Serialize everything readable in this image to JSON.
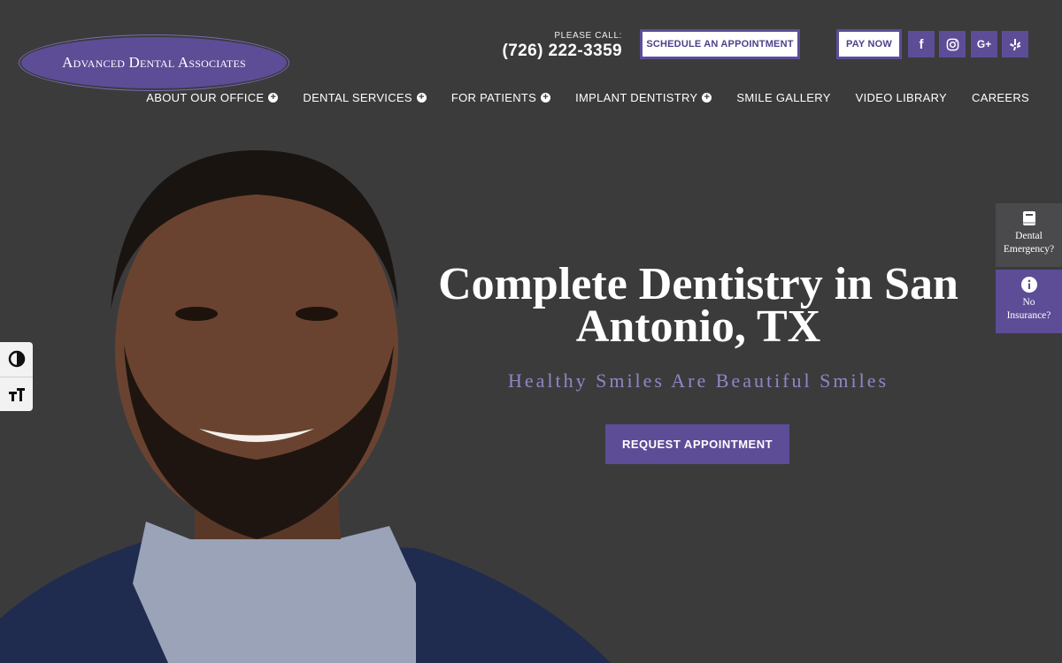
{
  "logo": {
    "text": "Advanced Dental Associates"
  },
  "header": {
    "call_label": "PLEASE CALL:",
    "phone": "(726) 222-3359",
    "schedule_label": "SCHEDULE AN APPOINTMENT",
    "pay_label": "PAY NOW",
    "social": [
      {
        "icon": "facebook-icon",
        "glyph": "f"
      },
      {
        "icon": "instagram-icon",
        "glyph": "◎"
      },
      {
        "icon": "google-plus-icon",
        "glyph": "G+"
      },
      {
        "icon": "yelp-icon",
        "glyph": "✻"
      }
    ]
  },
  "nav": {
    "items": [
      {
        "label": "ABOUT OUR OFFICE",
        "has_submenu": true
      },
      {
        "label": "DENTAL SERVICES",
        "has_submenu": true
      },
      {
        "label": "FOR PATIENTS",
        "has_submenu": true
      },
      {
        "label": "IMPLANT DENTISTRY",
        "has_submenu": true
      },
      {
        "label": "SMILE GALLERY",
        "has_submenu": false
      },
      {
        "label": "VIDEO LIBRARY",
        "has_submenu": false
      },
      {
        "label": "CAREERS",
        "has_submenu": false
      }
    ]
  },
  "hero": {
    "title_line1": "Complete Dentistry in San",
    "title_line2": "Antonio, TX",
    "subtitle": "Healthy Smiles Are Beautiful Smiles",
    "cta_label": "REQUEST APPOINTMENT"
  },
  "side_tabs": {
    "emergency_line1": "Dental",
    "emergency_line2": "Emergency?",
    "insurance_line1": "No",
    "insurance_line2": "Insurance?"
  },
  "colors": {
    "background": "#3b3b3c",
    "brand_purple": "#5d4d97",
    "subtitle_lavender": "#8f87c6"
  }
}
